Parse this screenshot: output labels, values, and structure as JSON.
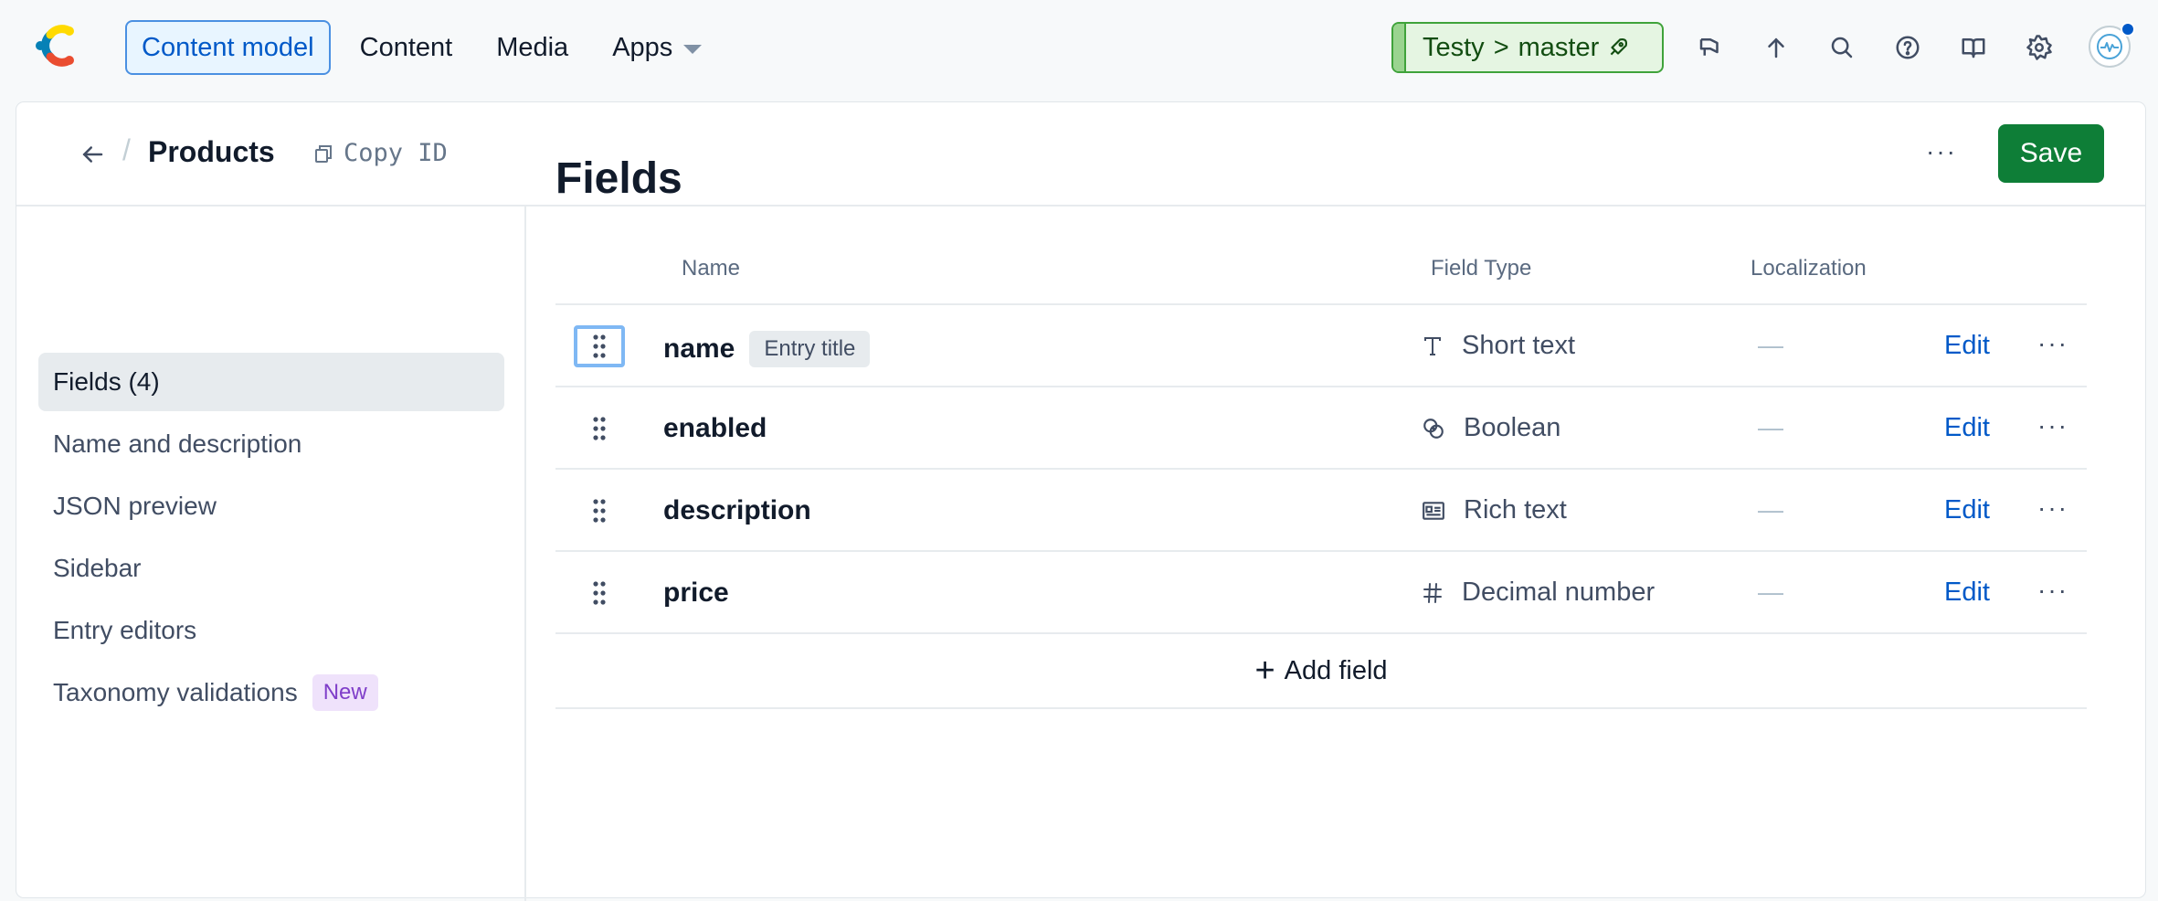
{
  "topbar": {
    "nav": [
      "Content model",
      "Content",
      "Media",
      "Apps"
    ],
    "env": {
      "space": "Testy",
      "separator": ">",
      "branch": "master"
    },
    "icons": [
      "announcement-icon",
      "arrow-up-icon",
      "search-icon",
      "help-icon",
      "docs-book-icon",
      "gear-icon"
    ]
  },
  "header": {
    "title": "Products",
    "copy_id_label": "Copy ID",
    "more_label": "···",
    "save_label": "Save"
  },
  "sidebar": {
    "items": [
      {
        "label": "Fields (4)"
      },
      {
        "label": "Name and description"
      },
      {
        "label": "JSON preview"
      },
      {
        "label": "Sidebar"
      },
      {
        "label": "Entry editors"
      },
      {
        "label": "Taxonomy validations",
        "badge": "New"
      }
    ]
  },
  "main": {
    "title": "Fields",
    "columns": [
      "Name",
      "Field Type",
      "Localization"
    ],
    "rows": [
      {
        "name": "name",
        "tag": "Entry title",
        "type": "Short text",
        "type_icon": "short-text-icon",
        "localization": "—",
        "edit": "Edit"
      },
      {
        "name": "enabled",
        "tag": "",
        "type": "Boolean",
        "type_icon": "boolean-icon",
        "localization": "—",
        "edit": "Edit"
      },
      {
        "name": "description",
        "tag": "",
        "type": "Rich text",
        "type_icon": "rich-text-icon",
        "localization": "—",
        "edit": "Edit"
      },
      {
        "name": "price",
        "tag": "",
        "type": "Decimal number",
        "type_icon": "number-icon",
        "localization": "—",
        "edit": "Edit"
      }
    ],
    "row_more": "···",
    "add_field_label": "Add field"
  },
  "colors": {
    "accent": "#0059c8",
    "save": "#0e7e37",
    "env_bg": "#e5f5e2",
    "env_border": "#3fa33a"
  }
}
